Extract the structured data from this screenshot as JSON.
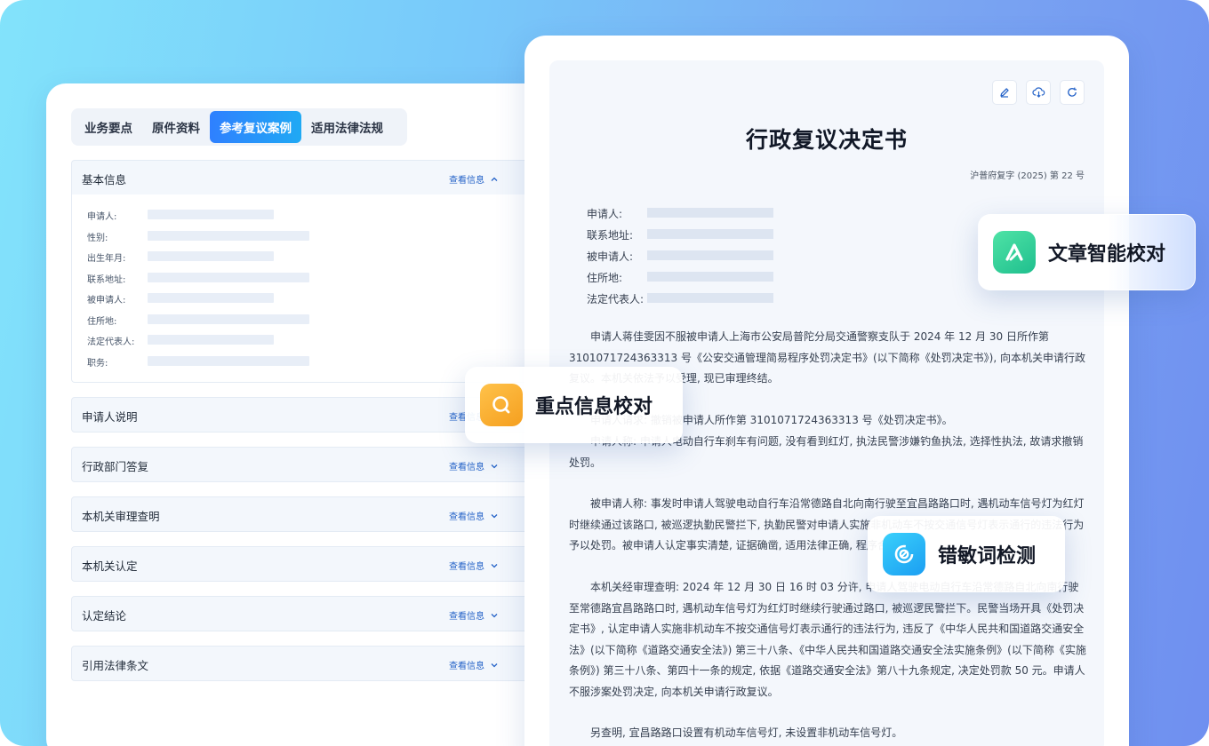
{
  "tabs": [
    "业务要点",
    "原件资料",
    "参考复议案例",
    "适用法律法规"
  ],
  "active_tab": 2,
  "left": {
    "basic_info": {
      "title": "基本信息",
      "link": "查看信息",
      "fields": [
        "申请人:",
        "性别:",
        "出生年月:",
        "联系地址:",
        "被申请人:",
        "住所地:",
        "法定代表人:",
        "职务:"
      ]
    },
    "sections": [
      {
        "title": "申请人说明",
        "link": "查看信息"
      },
      {
        "title": "行政部门答复",
        "link": "查看信息"
      },
      {
        "title": "本机关审理查明",
        "link": "查看信息"
      },
      {
        "title": "本机关认定",
        "link": "查看信息"
      },
      {
        "title": "认定结论",
        "link": "查看信息"
      },
      {
        "title": "引用法律条文",
        "link": "查看信息"
      }
    ]
  },
  "doc": {
    "title": "行政复议决定书",
    "number": "沪普府复字 (2025) 第 22 号",
    "parties": [
      "申请人:",
      "联系地址:",
      "被申请人:",
      "住所地:",
      "法定代表人:"
    ],
    "paragraphs": [
      "申请人蒋佳雯因不服被申请人上海市公安局普陀分局交通警察支队于 2024 年 12 月 30 日所作第 3101071724363313 号《公安交通管理简易程序处罚决定书》(以下简称《处罚决定书》), 向本机关申请行政复议。本机关依法予以受理, 现已审理终结。",
      "申请人请求: 撤销被申请人所作第 3101071724363313 号《处罚决定书》。",
      "申请人称: 申请人电动自行车刹车有问题, 没有看到红灯, 执法民警涉嫌钓鱼执法, 选择性执法, 故请求撤销处罚。",
      "被申请人称: 事发时申请人驾驶电动自行车沿常德路自北向南行驶至宜昌路路口时, 遇机动车信号灯为红灯时继续通过该路口, 被巡逻执勤民警拦下, 执勤民警对申请人实施非机动车不按交通信号灯表示通行的违法行为予以处罚。被申请人认定事实清楚, 证据确凿, 适用法律正确, 程序合法。",
      "本机关经审理查明: 2024 年 12 月 30 日 16 时 03 分许, 申请人驾驶电动自行车沿常德路自北向南行驶至常德路宜昌路路口时, 遇机动车信号灯为红灯时继续行驶通过路口, 被巡逻民警拦下。民警当场开具《处罚决定书》, 认定申请人实施非机动车不按交通信号灯表示通行的违法行为, 违反了《中华人民共和国道路交通安全法》(以下简称《道路交通安全法》) 第三十八条、《中华人民共和国道路交通安全法实施条例》(以下简称《实施条例》) 第三十八条、第四十一条的规定, 依据《道路交通安全法》第八十九条规定, 决定处罚款 50 元。申请人不服涉案处罚决定, 向本机关申请行政复议。",
      "另查明, 宜昌路路口设置有机动车信号灯, 未设置非机动车信号灯。"
    ]
  },
  "badges": {
    "article": "文章智能校对",
    "key_info": "重点信息校对",
    "sensitive": "错敏词检测"
  },
  "colors": {
    "accent": "#2f80ff",
    "link": "#2563c8",
    "badge_green": "#2fd399",
    "badge_orange": "#fbae2c",
    "badge_cyan": "#1eb8f5"
  },
  "icons": [
    "edit-icon",
    "cloud-download-icon",
    "refresh-icon",
    "chevron-up-icon",
    "chevron-down-icon",
    "proofread-logo-icon",
    "search-icon",
    "sensitive-detect-icon"
  ]
}
